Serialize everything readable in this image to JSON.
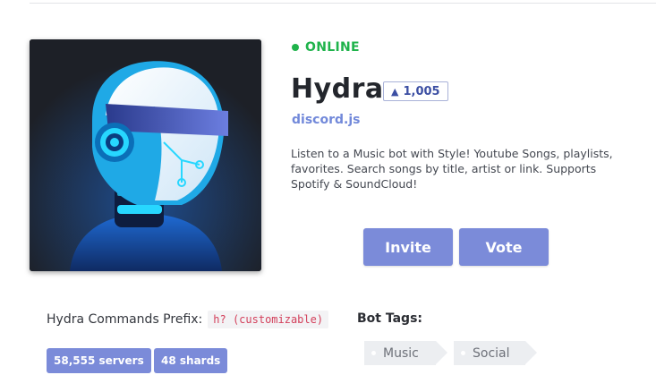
{
  "status": {
    "text": "ONLINE",
    "color": "#1fb34b"
  },
  "bot": {
    "name": "Hydra",
    "upvotes": "1,005",
    "library": "discord.js",
    "description": "Listen to a Music bot with Style! Youtube Songs, playlists, favorites. Search songs by title, artist or link. Supports Spotify & SoundCloud!"
  },
  "actions": {
    "invite_label": "Invite",
    "vote_label": "Vote"
  },
  "prefix": {
    "label": "Hydra Commands Prefix:",
    "value": "h? (customizable)"
  },
  "stats": {
    "servers": "58,555 servers",
    "shards": "48 shards"
  },
  "tags": {
    "title": "Bot Tags:",
    "items": [
      "Music",
      "Social"
    ]
  },
  "icons": {
    "upvote": "chevron-up-icon",
    "status": "status-dot-icon",
    "avatar": "robot-helmet-avatar"
  },
  "colors": {
    "accent": "#7b8bd9",
    "library": "#7289da",
    "background": "#ffffff"
  }
}
